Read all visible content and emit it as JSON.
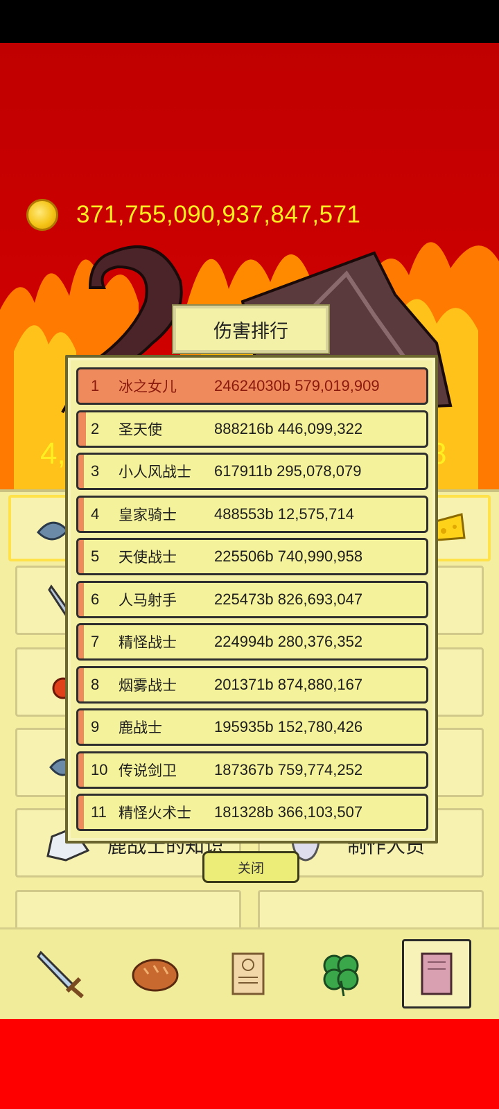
{
  "currency": {
    "amount": "371,755,090,937,847,571",
    "icon": "gold-coin-icon"
  },
  "background_stats": {
    "left_partial": "4,",
    "right_partial": "8"
  },
  "panel": {
    "tile_knowledge_label": "鹿战士的知识",
    "tile_credits_label": "制作人员"
  },
  "modal": {
    "title": "伤害排行",
    "close_label": "关闭",
    "rankings": [
      {
        "rank": "1",
        "name": "冰之女儿",
        "damage": "24624030b 579,019,909",
        "share": 1.0
      },
      {
        "rank": "2",
        "name": "圣天使",
        "damage": "888216b 446,099,322",
        "share": 0.036
      },
      {
        "rank": "3",
        "name": "小人风战士",
        "damage": "617911b 295,078,079",
        "share": 0.025
      },
      {
        "rank": "4",
        "name": "皇家骑士",
        "damage": "488553b 12,575,714",
        "share": 0.02
      },
      {
        "rank": "5",
        "name": "天使战士",
        "damage": "225506b 740,990,958",
        "share": 0.009
      },
      {
        "rank": "6",
        "name": "人马射手",
        "damage": "225473b 826,693,047",
        "share": 0.009
      },
      {
        "rank": "7",
        "name": "精怪战士",
        "damage": "224994b 280,376,352",
        "share": 0.009
      },
      {
        "rank": "8",
        "name": "烟雾战士",
        "damage": "201371b 874,880,167",
        "share": 0.008
      },
      {
        "rank": "9",
        "name": "鹿战士",
        "damage": "195935b 152,780,426",
        "share": 0.008
      },
      {
        "rank": "10",
        "name": "传说剑卫",
        "damage": "187367b 759,774,252",
        "share": 0.008
      },
      {
        "rank": "11",
        "name": "精怪火术士",
        "damage": "181328b 366,103,507",
        "share": 0.007
      }
    ]
  },
  "nav": [
    {
      "icon": "sword-icon"
    },
    {
      "icon": "bread-icon"
    },
    {
      "icon": "scroll-icon"
    },
    {
      "icon": "clover-icon"
    },
    {
      "icon": "book-icon",
      "active": true
    }
  ],
  "colors": {
    "highlight": "#ee8a5c",
    "gold": "#ffee22",
    "panel": "#f4f1a6"
  }
}
